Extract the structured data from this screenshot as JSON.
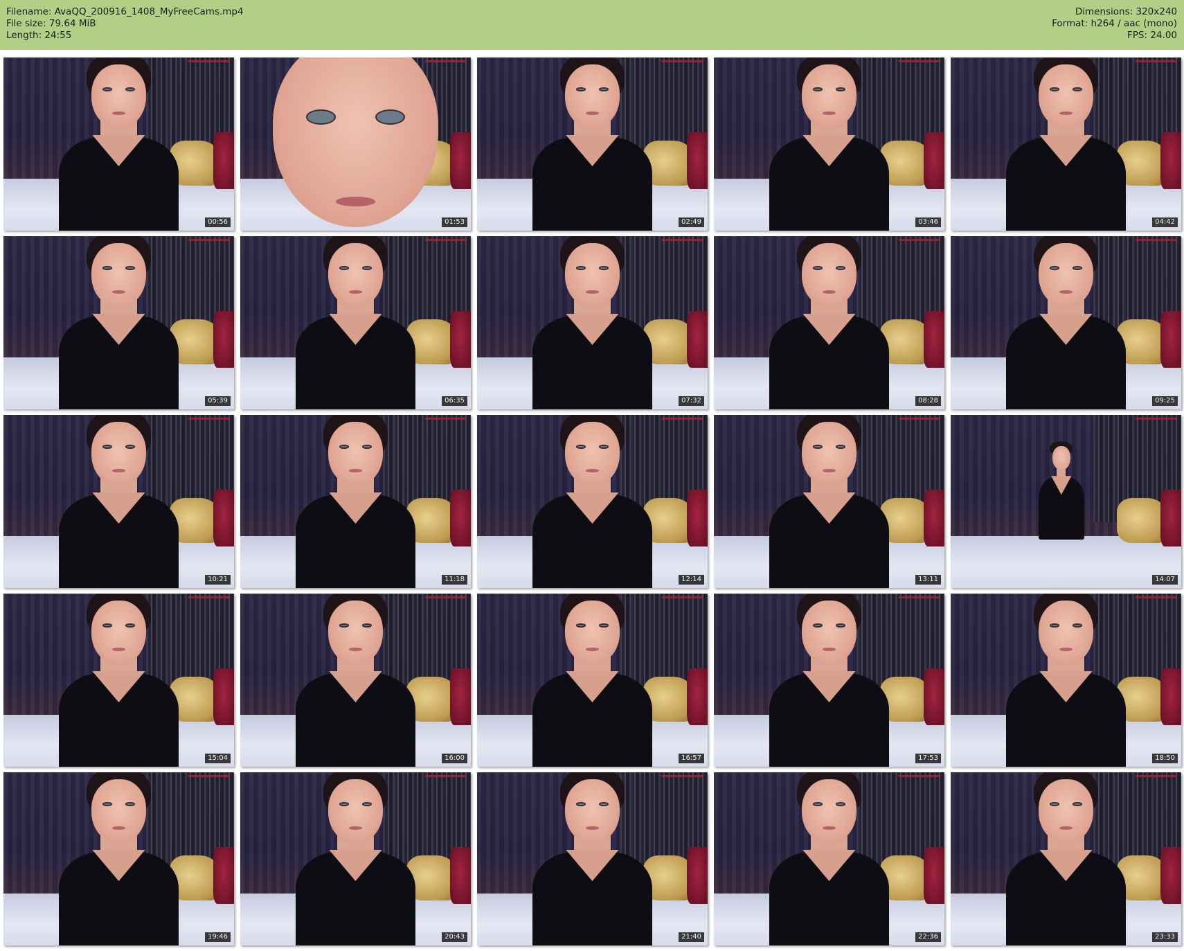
{
  "header": {
    "filename_line": "Filename: AvaQQ_200916_1408_MyFreeCams.mp4",
    "filesize_line": "File size: 79.64 MiB",
    "length_line": "Length: 24:55",
    "dimensions_line": "Dimensions: 320x240",
    "format_line": "Format: h264 / aac (mono)",
    "fps_line": "FPS: 24.00",
    "background_color": "#b2cf86"
  },
  "thumbnails": [
    {
      "timestamp": "00:56",
      "variant": "normal"
    },
    {
      "timestamp": "01:53",
      "variant": "closeup"
    },
    {
      "timestamp": "02:49",
      "variant": "normal"
    },
    {
      "timestamp": "03:46",
      "variant": "normal"
    },
    {
      "timestamp": "04:42",
      "variant": "normal"
    },
    {
      "timestamp": "05:39",
      "variant": "normal"
    },
    {
      "timestamp": "06:35",
      "variant": "normal"
    },
    {
      "timestamp": "07:32",
      "variant": "normal"
    },
    {
      "timestamp": "08:28",
      "variant": "normal"
    },
    {
      "timestamp": "09:25",
      "variant": "normal"
    },
    {
      "timestamp": "10:21",
      "variant": "normal"
    },
    {
      "timestamp": "11:18",
      "variant": "normal"
    },
    {
      "timestamp": "12:14",
      "variant": "normal"
    },
    {
      "timestamp": "13:11",
      "variant": "normal"
    },
    {
      "timestamp": "14:07",
      "variant": "wide"
    },
    {
      "timestamp": "15:04",
      "variant": "normal"
    },
    {
      "timestamp": "16:00",
      "variant": "normal"
    },
    {
      "timestamp": "16:57",
      "variant": "normal"
    },
    {
      "timestamp": "17:53",
      "variant": "normal"
    },
    {
      "timestamp": "18:50",
      "variant": "normal"
    },
    {
      "timestamp": "19:46",
      "variant": "normal"
    },
    {
      "timestamp": "20:43",
      "variant": "normal"
    },
    {
      "timestamp": "21:40",
      "variant": "normal"
    },
    {
      "timestamp": "22:36",
      "variant": "normal"
    },
    {
      "timestamp": "23:33",
      "variant": "normal"
    }
  ]
}
